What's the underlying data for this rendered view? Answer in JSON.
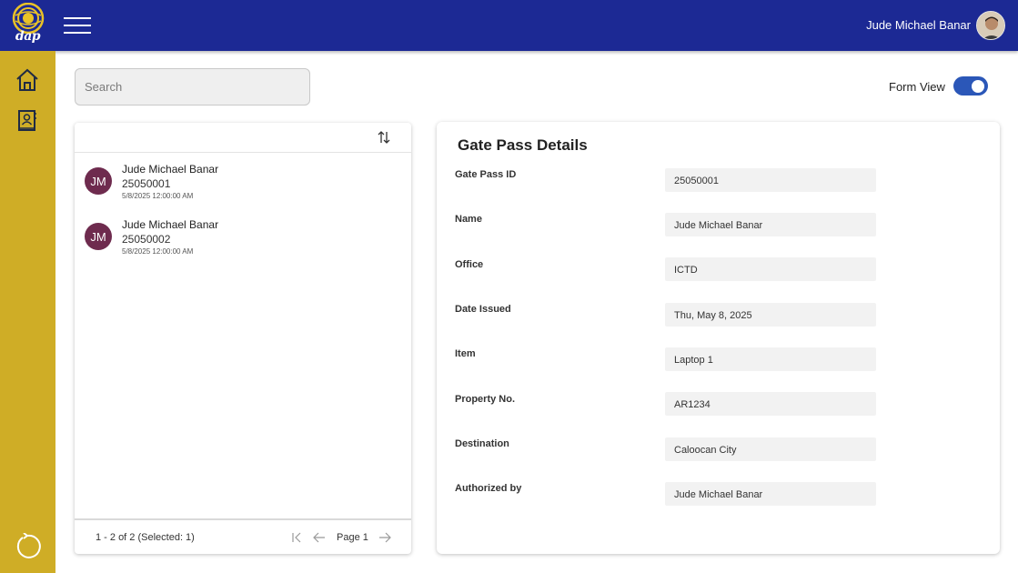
{
  "header": {
    "logo_text": "dap",
    "user_name": "Jude Michael Banar",
    "colors": {
      "header_bg": "#1c2994",
      "sidebar_bg": "#cfad26",
      "accent": "#2b57b8",
      "avatar_bg": "#6e2b4e"
    }
  },
  "sidebar": {
    "items": [
      {
        "icon": "home-icon"
      },
      {
        "icon": "contact-book-icon"
      }
    ],
    "bottom_icon": "refresh-icon"
  },
  "search": {
    "placeholder": "Search",
    "value": ""
  },
  "form_view": {
    "label": "Form View",
    "enabled": true
  },
  "list": {
    "items": [
      {
        "initials": "JM",
        "name": "Jude Michael Banar",
        "id": "25050001",
        "date": "5/8/2025 12:00:00 AM",
        "selected": true
      },
      {
        "initials": "JM",
        "name": "Jude Michael Banar",
        "id": "25050002",
        "date": "5/8/2025 12:00:00 AM",
        "selected": false
      }
    ],
    "range_text": "1 - 2 of 2 (Selected: 1)",
    "page_label": "Page 1"
  },
  "details": {
    "title": "Gate Pass Details",
    "fields": [
      {
        "label": "Gate Pass ID",
        "value": "25050001"
      },
      {
        "label": "Name",
        "value": "Jude Michael Banar"
      },
      {
        "label": "Office",
        "value": "ICTD"
      },
      {
        "label": "Date Issued",
        "value": "Thu, May 8, 2025"
      },
      {
        "label": "Item",
        "value": "Laptop 1"
      },
      {
        "label": "Property No.",
        "value": "AR1234"
      },
      {
        "label": "Destination",
        "value": "Caloocan City"
      },
      {
        "label": "Authorized by",
        "value": "Jude Michael Banar"
      }
    ]
  }
}
